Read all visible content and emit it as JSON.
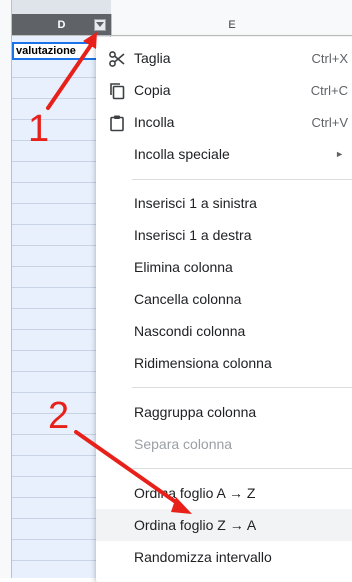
{
  "sheet": {
    "col_d_label": "D",
    "col_e_label": "E",
    "cell_d1_value": "valutazione"
  },
  "context_menu": {
    "items": [
      {
        "label": "Taglia",
        "shortcut": "Ctrl+X",
        "icon": "scissors-icon"
      },
      {
        "label": "Copia",
        "shortcut": "Ctrl+C",
        "icon": "copy-icon"
      },
      {
        "label": "Incolla",
        "shortcut": "Ctrl+V",
        "icon": "clipboard-icon"
      },
      {
        "label": "Incolla speciale",
        "submenu_arrow": "►"
      },
      {
        "label": "Inserisci 1 a sinistra"
      },
      {
        "label": "Inserisci 1 a destra"
      },
      {
        "label": "Elimina colonna"
      },
      {
        "label": "Cancella colonna"
      },
      {
        "label": "Nascondi colonna"
      },
      {
        "label": "Ridimensiona colonna"
      },
      {
        "label": "Raggruppa colonna"
      },
      {
        "label": "Separa colonna",
        "disabled": true
      },
      {
        "label": "Ordina foglio A → Z"
      },
      {
        "label": "Ordina foglio Z → A",
        "highlighted": true
      },
      {
        "label": "Randomizza intervallo"
      }
    ]
  },
  "annotations": {
    "marker_1": "1",
    "marker_2": "2",
    "color": "#e8201a"
  },
  "colors": {
    "selected_column_header": "#5f6368",
    "selected_column_fill": "#e8f0fe",
    "active_cell_border": "#1a73e8",
    "menu_hover": "#f1f3f4"
  }
}
